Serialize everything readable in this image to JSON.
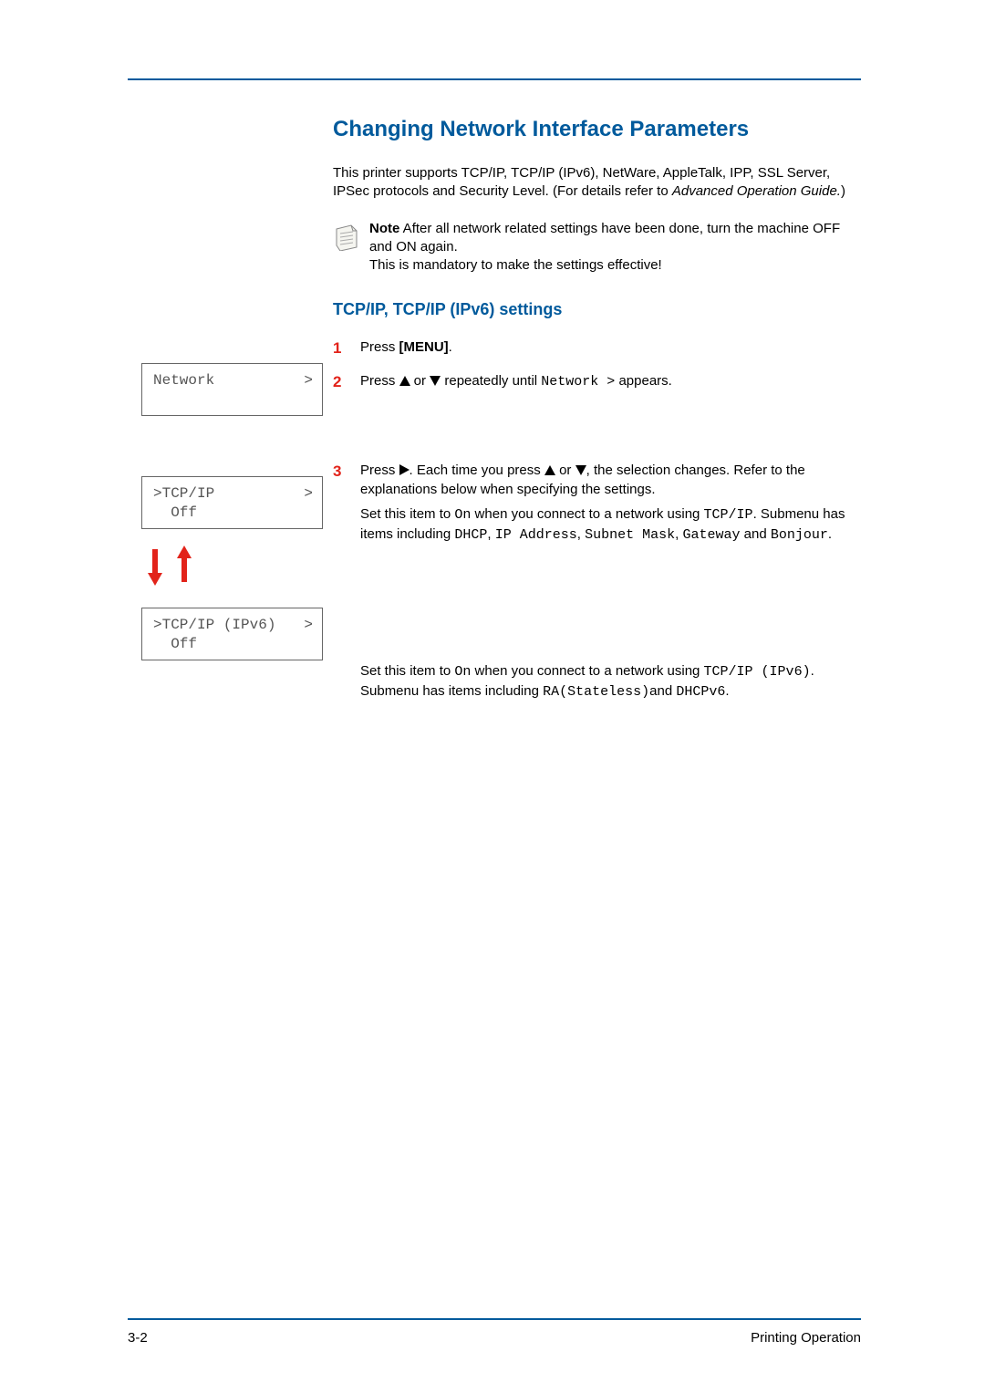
{
  "heading": "Changing Network Interface Parameters",
  "intro": {
    "line1": "This printer supports TCP/IP, TCP/IP (IPv6), NetWare, AppleTalk, IPP, SSL Server, IPSec protocols and Security Level. (For details refer to",
    "guide": "Advanced Operation Guide.",
    "closeParen": ")"
  },
  "note": {
    "label": "Note",
    "line1": "  After all network related settings have been done, turn the machine OFF and ON again.",
    "line2": "This is mandatory to make the settings effective!"
  },
  "subheading": "TCP/IP, TCP/IP (IPv6) settings",
  "steps": {
    "s1": {
      "num": "1",
      "pre": "Press ",
      "menu": "[MENU]",
      "post": "."
    },
    "s2": {
      "num": "2",
      "a": "Press ",
      "b": " or ",
      "c": " repeatedly until ",
      "code": "Network  >",
      "d": " appears."
    },
    "s3": {
      "num": "3",
      "a": "Press ",
      "b": ". Each time you press ",
      "c": " or ",
      "d": ", the selection changes. Refer to the explanations below when specifying the settings.",
      "desc1a": "Set this item to ",
      "desc1on": "On",
      "desc1b": " when you connect to a network using ",
      "desc1tcp": "TCP/IP",
      "desc1c": ". Submenu has items including ",
      "desc1dhcp": "DHCP",
      "desc1d": ", ",
      "desc1ip": "IP Address",
      "desc1e": ", ",
      "desc1sub": "Subnet Mask",
      "desc1f": ", ",
      "desc1gw": "Gateway",
      "desc1g": " and ",
      "desc1bj": "Bonjour",
      "desc1h": ".",
      "desc2a": "Set this item to ",
      "desc2on": "On",
      "desc2b": " when you connect to a network using ",
      "desc2tcp": "TCP/IP (IPv6)",
      "desc2c": ". Submenu has items including ",
      "desc2ra": "RA(Stateless)",
      "desc2d": "and ",
      "desc2dh": "DHCPv6",
      "desc2e": "."
    }
  },
  "lcd1": {
    "line1": "Network",
    "arrow": ">"
  },
  "lcd2": {
    "line1": ">TCP/IP",
    "line2": "  Off",
    "arrow": ">"
  },
  "lcd3": {
    "line1": ">TCP/IP (IPv6)",
    "line2": "  Off",
    "arrow": ">"
  },
  "footer": {
    "page": "3-2",
    "section": "Printing Operation"
  }
}
